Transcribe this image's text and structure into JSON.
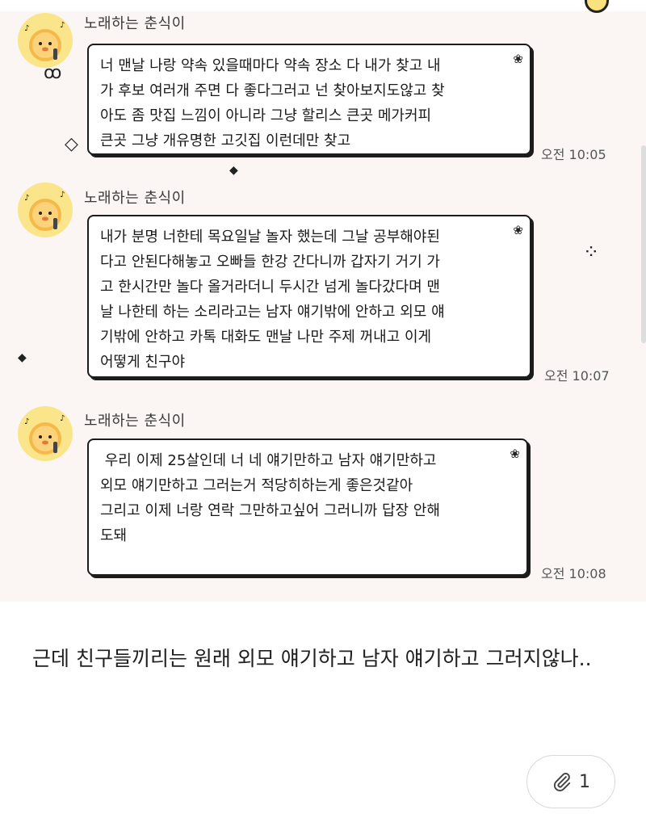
{
  "messages": [
    {
      "sender": "노래하는 춘식이",
      "lines": [
        "너 맨날 나랑 약속 있을때마다 약속 장소 다 내가 찾고 내",
        "가 후보 여러개 주면 다 좋다그러고 넌 찾아보지도않고 찾",
        "아도 좀 맛집 느낌이 아니라 그냥 할리스 큰곳 메가커피",
        "큰곳 그냥 개유명한 고깃집 이런데만 찾고"
      ],
      "time": "오전 10:05"
    },
    {
      "sender": "노래하는 춘식이",
      "lines": [
        "내가 분명 너한테 목요일날 놀자 했는데 그날 공부해야된",
        "다고 안된다해놓고 오빠들 한강 간다니까 갑자기 거기 가",
        "고 한시간만 놀다 올거라더니 두시간 넘게 놀다갔다며 맨",
        "날 나한테 하는 소리라고는 남자 얘기밖에 안하고 외모 얘",
        "기밖에 안하고 카톡 대화도 맨날 나만 주제 꺼내고 이게",
        "어떻게 친구야"
      ],
      "time": "오전 10:07"
    },
    {
      "sender": "노래하는 춘식이",
      "lines": [
        " 우리 이제 25살인데 너 네 얘기만하고 남자 얘기만하고",
        "외모 얘기만하고 그러는거 적당히하는게 좋은것같아",
        "",
        "그리고 이제 너랑 연락 그만하고싶어 그러니까 답장 안해",
        "도돼"
      ],
      "time": "오전 10:08"
    }
  ],
  "post": {
    "body": "근데 친구들끼리는 원래 외모 얘기하고 남자 얘기하고 그러지않나.."
  },
  "attachment": {
    "count": "1",
    "icon": "paperclip-icon"
  },
  "colors": {
    "chat_background": "#fbf5f4",
    "bubble_border": "#1c1c1c",
    "avatar": "#fbe58a"
  }
}
